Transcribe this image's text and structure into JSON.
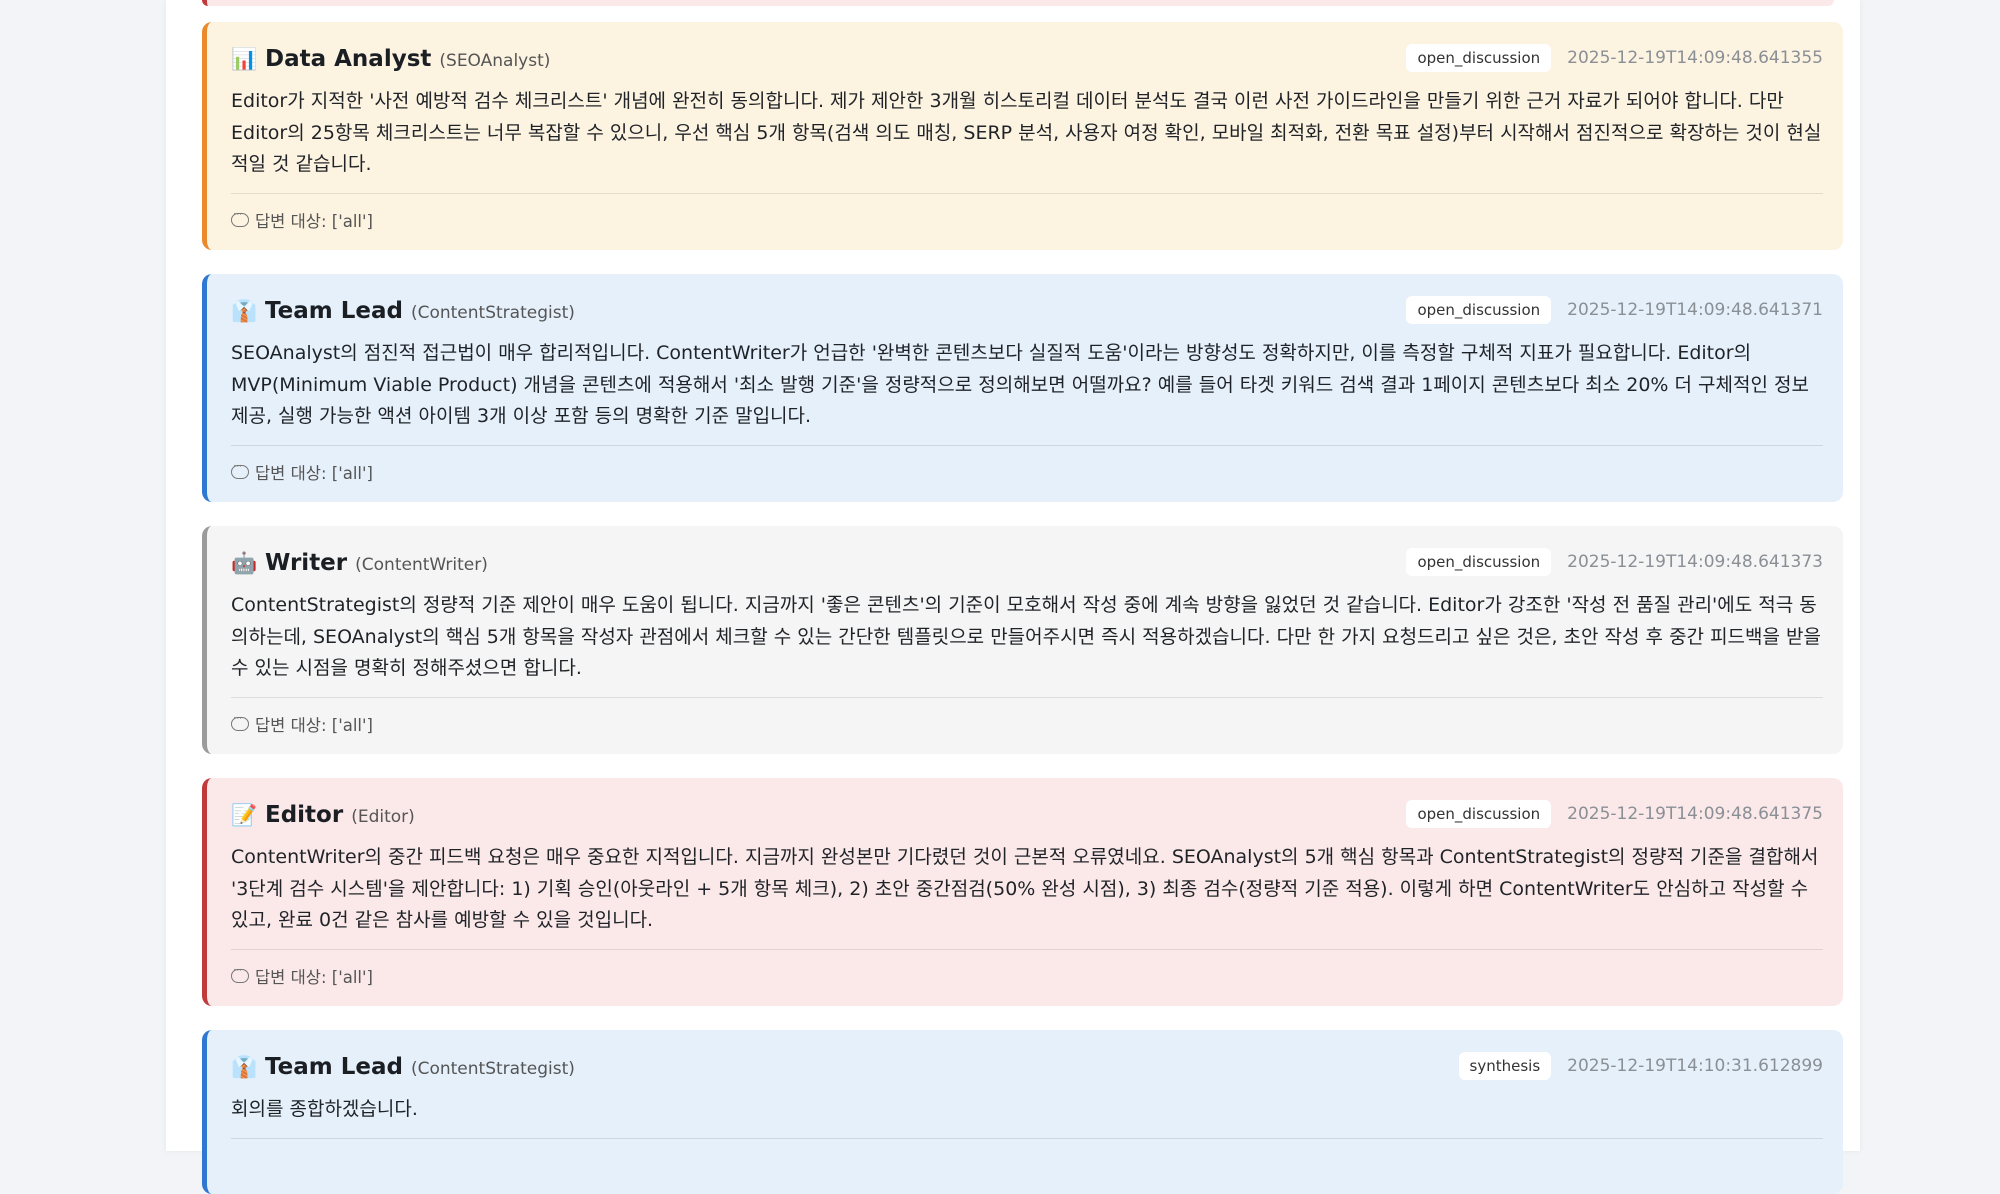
{
  "messages": [
    {
      "emoji": "📊",
      "name": "Data Analyst",
      "role": "(SEOAnalyst)",
      "tag": "open_discussion",
      "timestamp": "2025-12-19T14:09:48.641355",
      "text": "Editor가 지적한 '사전 예방적 검수 체크리스트' 개념에 완전히 동의합니다. 제가 제안한 3개월 히스토리컬 데이터 분석도 결국 이런 사전 가이드라인을 만들기 위한 근거 자료가 되어야 합니다. 다만 Editor의 25항목 체크리스트는 너무 복잡할 수 있으니, 우선 핵심 5개 항목(검색 의도 매칭, SERP 분석, 사용자 여정 확인, 모바일 최적화, 전환 목표 설정)부터 시작해서 점진적으로 확장하는 것이 현실적일 것 같습니다.",
      "reply": "답변 대상: ['all']"
    },
    {
      "emoji": "👔",
      "name": "Team Lead",
      "role": "(ContentStrategist)",
      "tag": "open_discussion",
      "timestamp": "2025-12-19T14:09:48.641371",
      "text": "SEOAnalyst의 점진적 접근법이 매우 합리적입니다. ContentWriter가 언급한 '완벽한 콘텐츠보다 실질적 도움'이라는 방향성도 정확하지만, 이를 측정할 구체적 지표가 필요합니다. Editor의 MVP(Minimum Viable Product) 개념을 콘텐츠에 적용해서 '최소 발행 기준'을 정량적으로 정의해보면 어떨까요? 예를 들어 타겟 키워드 검색 결과 1페이지 콘텐츠보다 최소 20% 더 구체적인 정보 제공, 실행 가능한 액션 아이템 3개 이상 포함 등의 명확한 기준 말입니다.",
      "reply": "답변 대상: ['all']"
    },
    {
      "emoji": "🤖",
      "name": "Writer",
      "role": "(ContentWriter)",
      "tag": "open_discussion",
      "timestamp": "2025-12-19T14:09:48.641373",
      "text": "ContentStrategist의 정량적 기준 제안이 매우 도움이 됩니다. 지금까지 '좋은 콘텐츠'의 기준이 모호해서 작성 중에 계속 방향을 잃었던 것 같습니다. Editor가 강조한 '작성 전 품질 관리'에도 적극 동의하는데, SEOAnalyst의 핵심 5개 항목을 작성자 관점에서 체크할 수 있는 간단한 템플릿으로 만들어주시면 즉시 적용하겠습니다. 다만 한 가지 요청드리고 싶은 것은, 초안 작성 후 중간 피드백을 받을 수 있는 시점을 명확히 정해주셨으면 합니다.",
      "reply": "답변 대상: ['all']"
    },
    {
      "emoji": "📝",
      "name": "Editor",
      "role": "(Editor)",
      "tag": "open_discussion",
      "timestamp": "2025-12-19T14:09:48.641375",
      "text": "ContentWriter의 중간 피드백 요청은 매우 중요한 지적입니다. 지금까지 완성본만 기다렸던 것이 근본적 오류였네요. SEOAnalyst의 5개 핵심 항목과 ContentStrategist의 정량적 기준을 결합해서 '3단계 검수 시스템'을 제안합니다: 1) 기획 승인(아웃라인 + 5개 항목 체크), 2) 초안 중간점검(50% 완성 시점), 3) 최종 검수(정량적 기준 적용). 이렇게 하면 ContentWriter도 안심하고 작성할 수 있고, 완료 0건 같은 참사를 예방할 수 있을 것입니다.",
      "reply": "답변 대상: ['all']"
    },
    {
      "emoji": "👔",
      "name": "Team Lead",
      "role": "(ContentStrategist)",
      "tag": "synthesis",
      "timestamp": "2025-12-19T14:10:31.612899",
      "text": "회의를 종합하겠습니다.",
      "reply": ""
    }
  ]
}
